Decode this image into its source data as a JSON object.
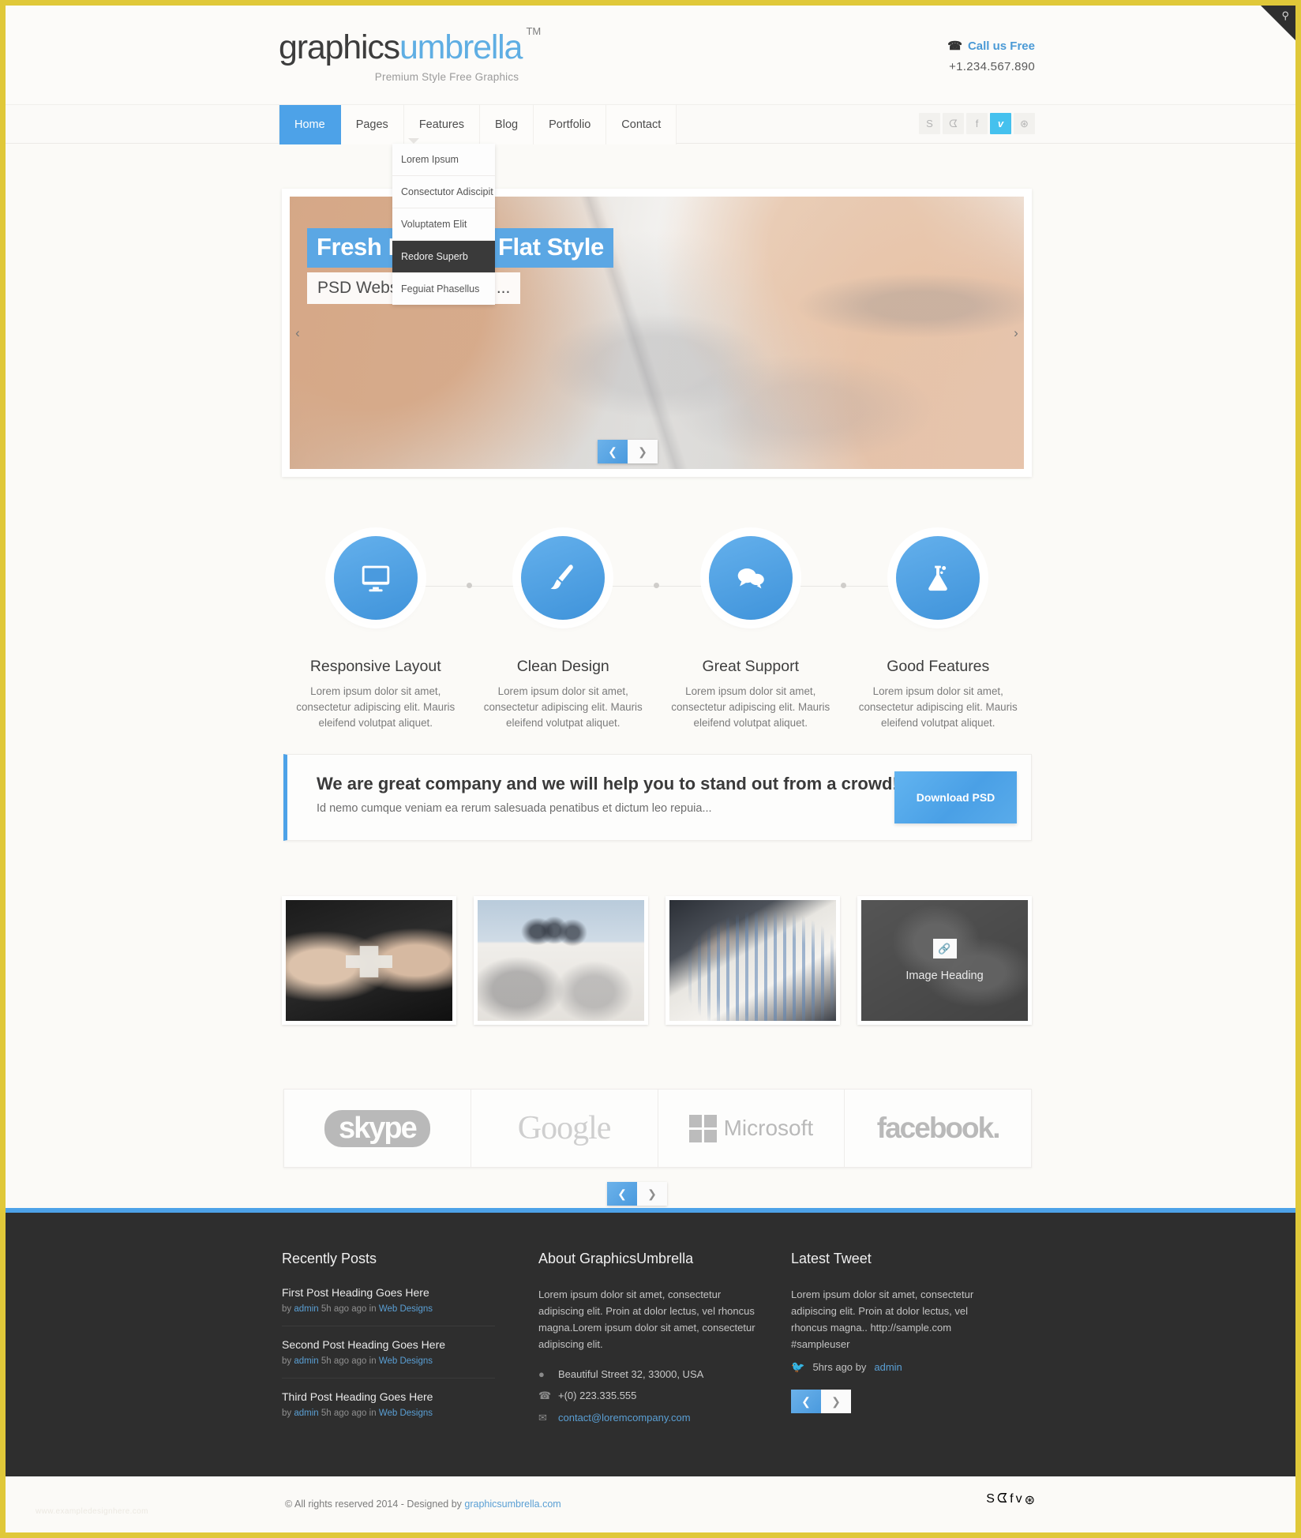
{
  "brand": {
    "name_dark": "graphics",
    "name_blue": "umbrella",
    "tm": "TM",
    "tagline": "Premium Style Free Graphics"
  },
  "header": {
    "call_label": "Call us Free",
    "phone": "+1.234.567.890",
    "phone_icon": "telephone-icon",
    "search_icon": "search-icon"
  },
  "nav": {
    "items": [
      {
        "label": "Home",
        "active": true
      },
      {
        "label": "Pages",
        "active": false
      },
      {
        "label": "Features",
        "active": false
      },
      {
        "label": "Blog",
        "active": false
      },
      {
        "label": "Portfolio",
        "active": false
      },
      {
        "label": "Contact",
        "active": false
      }
    ],
    "dropdown": {
      "parent": "Features",
      "items": [
        {
          "label": "Lorem Ipsum",
          "highlighted": false
        },
        {
          "label": "Consectutor Adiscipit",
          "highlighted": false
        },
        {
          "label": "Voluptatem Elit",
          "highlighted": false
        },
        {
          "label": "Redore Superb",
          "highlighted": true
        },
        {
          "label": "Feguiat Phasellus",
          "highlighted": false
        }
      ]
    },
    "social": [
      {
        "name": "skype-icon",
        "glyph": "S",
        "active": false
      },
      {
        "name": "twitter-icon",
        "glyph": "ᗧ",
        "active": false
      },
      {
        "name": "facebook-icon",
        "glyph": "f",
        "active": false
      },
      {
        "name": "vimeo-icon",
        "glyph": "v",
        "active": true
      },
      {
        "name": "dribbble-icon",
        "glyph": "⊛",
        "active": false
      }
    ]
  },
  "slider": {
    "heading": "Fresh Design & Flat Style",
    "subheading": "PSD Website Template.....",
    "prev_arrow": "‹",
    "next_arrow": "›",
    "pager": {
      "prev": "❮",
      "next": "❯"
    }
  },
  "features": [
    {
      "icon": "monitor-icon",
      "title": "Responsive Layout",
      "text": "Lorem ipsum dolor sit amet, consectetur adipiscing elit. Mauris eleifend volutpat aliquet."
    },
    {
      "icon": "paintbrush-icon",
      "title": "Clean Design",
      "text": "Lorem ipsum dolor sit amet, consectetur adipiscing elit. Mauris eleifend volutpat aliquet."
    },
    {
      "icon": "chat-bubbles-icon",
      "title": "Great Support",
      "text": "Lorem ipsum dolor sit amet, consectetur adipiscing elit. Mauris eleifend volutpat aliquet."
    },
    {
      "icon": "flask-icon",
      "title": "Good Features",
      "text": "Lorem ipsum dolor sit amet, consectetur adipiscing elit. Mauris eleifend volutpat aliquet."
    }
  ],
  "cta": {
    "heading": "We are great company and we will help you to stand out from a crowd!",
    "subtext": "Id nemo cumque veniam ea rerum salesuada penatibus et dictum leo repuia...",
    "button": "Download PSD"
  },
  "portfolio": {
    "items": [
      {
        "name": "puzzle-hands-thumb",
        "overlay": false
      },
      {
        "name": "office-desk-thumb",
        "overlay": false
      },
      {
        "name": "charts-meeting-thumb",
        "overlay": false
      },
      {
        "name": "image-heading-thumb",
        "overlay": true,
        "caption": "Image Heading",
        "link_icon": "link-icon"
      }
    ]
  },
  "clients": {
    "logos": [
      {
        "name": "skype-logo",
        "label": "skype"
      },
      {
        "name": "google-logo",
        "label": "Google"
      },
      {
        "name": "microsoft-logo",
        "label": "Microsoft"
      },
      {
        "name": "facebook-logo",
        "label": "facebook."
      }
    ],
    "pager": {
      "prev": "❮",
      "next": "❯"
    }
  },
  "footer": {
    "recent": {
      "title": "Recently Posts",
      "posts": [
        {
          "title": "First Post Heading Goes Here",
          "by": "by",
          "author": "admin",
          "time": "5h ago ago",
          "in": "in",
          "category": "Web Designs"
        },
        {
          "title": "Second Post Heading Goes Here",
          "by": "by",
          "author": "admin",
          "time": "5h ago ago",
          "in": "in",
          "category": "Web Designs"
        },
        {
          "title": "Third Post Heading Goes Here",
          "by": "by",
          "author": "admin",
          "time": "5h ago ago",
          "in": "in",
          "category": "Web Designs"
        }
      ]
    },
    "about": {
      "title": "About GraphicsUmbrella",
      "text": "Lorem ipsum dolor sit amet, consectetur adipiscing elit. Proin at dolor lectus, vel rhoncus magna.Lorem ipsum dolor sit amet, consectetur adipiscing elit.",
      "address": "Beautiful Street 32, 33000, USA",
      "phone": "+(0) 223.335.555",
      "email": "contact@loremcompany.com",
      "address_icon": "map-pin-icon",
      "phone_icon": "telephone-icon",
      "email_icon": "envelope-icon"
    },
    "tweet": {
      "title": "Latest Tweet",
      "text": "Lorem ipsum dolor sit amet, consectetur adipiscing elit. Proin at dolor lectus, vel rhoncus magna.. http://sample.com #sampleuser",
      "meta_time": "5hrs ago by",
      "meta_author": "admin",
      "twitter_icon": "twitter-icon",
      "pager": {
        "prev": "❮",
        "next": "❯"
      }
    }
  },
  "copyright": {
    "text": "© All rights reserved 2014  - Designed by",
    "link": "graphicsumbrella.com",
    "watermark": "www.exampledesignhere.com",
    "social": [
      {
        "name": "skype-icon",
        "glyph": "S",
        "active": false
      },
      {
        "name": "twitter-icon",
        "glyph": "ᗧ",
        "active": false
      },
      {
        "name": "facebook-icon",
        "glyph": "f",
        "active": false
      },
      {
        "name": "vimeo-icon",
        "glyph": "v",
        "active": true
      },
      {
        "name": "dribbble-icon",
        "glyph": "⊛",
        "active": false
      }
    ]
  }
}
